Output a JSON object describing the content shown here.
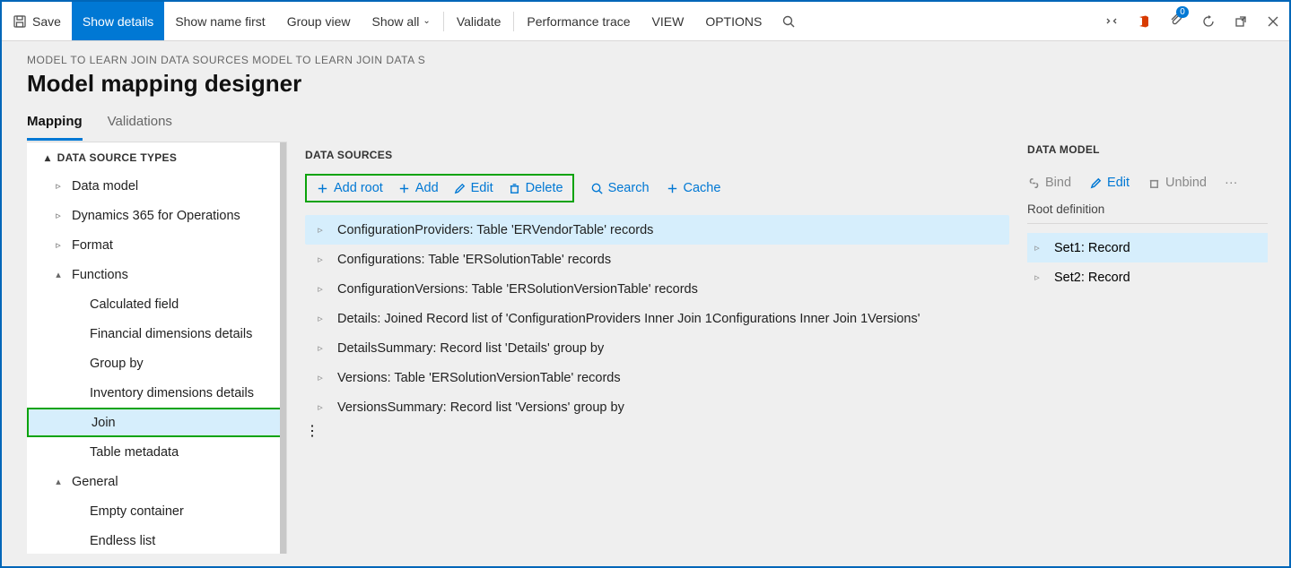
{
  "cmd": {
    "save": "Save",
    "show_details": "Show details",
    "show_name_first": "Show name first",
    "group_view": "Group view",
    "show_all": "Show all",
    "validate": "Validate",
    "perf_trace": "Performance trace",
    "view": "VIEW",
    "options": "OPTIONS",
    "notif_count": "0"
  },
  "breadcrumb": "MODEL TO LEARN JOIN DATA SOURCES MODEL TO LEARN JOIN DATA S",
  "title": "Model mapping designer",
  "tabs": {
    "mapping": "Mapping",
    "validations": "Validations"
  },
  "left": {
    "title": "DATA SOURCE TYPES",
    "items": {
      "data_model": "Data model",
      "d365": "Dynamics 365 for Operations",
      "format": "Format",
      "functions": "Functions",
      "calc_field": "Calculated field",
      "fin_dim": "Financial dimensions details",
      "group_by": "Group by",
      "inv_dim": "Inventory dimensions details",
      "join": "Join",
      "table_meta": "Table metadata",
      "general": "General",
      "empty_container": "Empty container",
      "endless_list": "Endless list"
    }
  },
  "mid": {
    "title": "DATA SOURCES",
    "toolbar": {
      "add_root": "Add root",
      "add": "Add",
      "edit": "Edit",
      "delete": "Delete",
      "search": "Search",
      "cache": "Cache"
    },
    "rows": [
      "ConfigurationProviders: Table 'ERVendorTable' records",
      "Configurations: Table 'ERSolutionTable' records",
      "ConfigurationVersions: Table 'ERSolutionVersionTable' records",
      "Details: Joined Record list of 'ConfigurationProviders Inner Join 1Configurations Inner Join 1Versions'",
      "DetailsSummary: Record list 'Details' group by",
      "Versions: Table 'ERSolutionVersionTable' records",
      "VersionsSummary: Record list 'Versions' group by"
    ]
  },
  "right": {
    "title": "DATA MODEL",
    "toolbar": {
      "bind": "Bind",
      "edit": "Edit",
      "unbind": "Unbind"
    },
    "subtitle": "Root definition",
    "rows": [
      "Set1: Record",
      "Set2: Record"
    ]
  }
}
